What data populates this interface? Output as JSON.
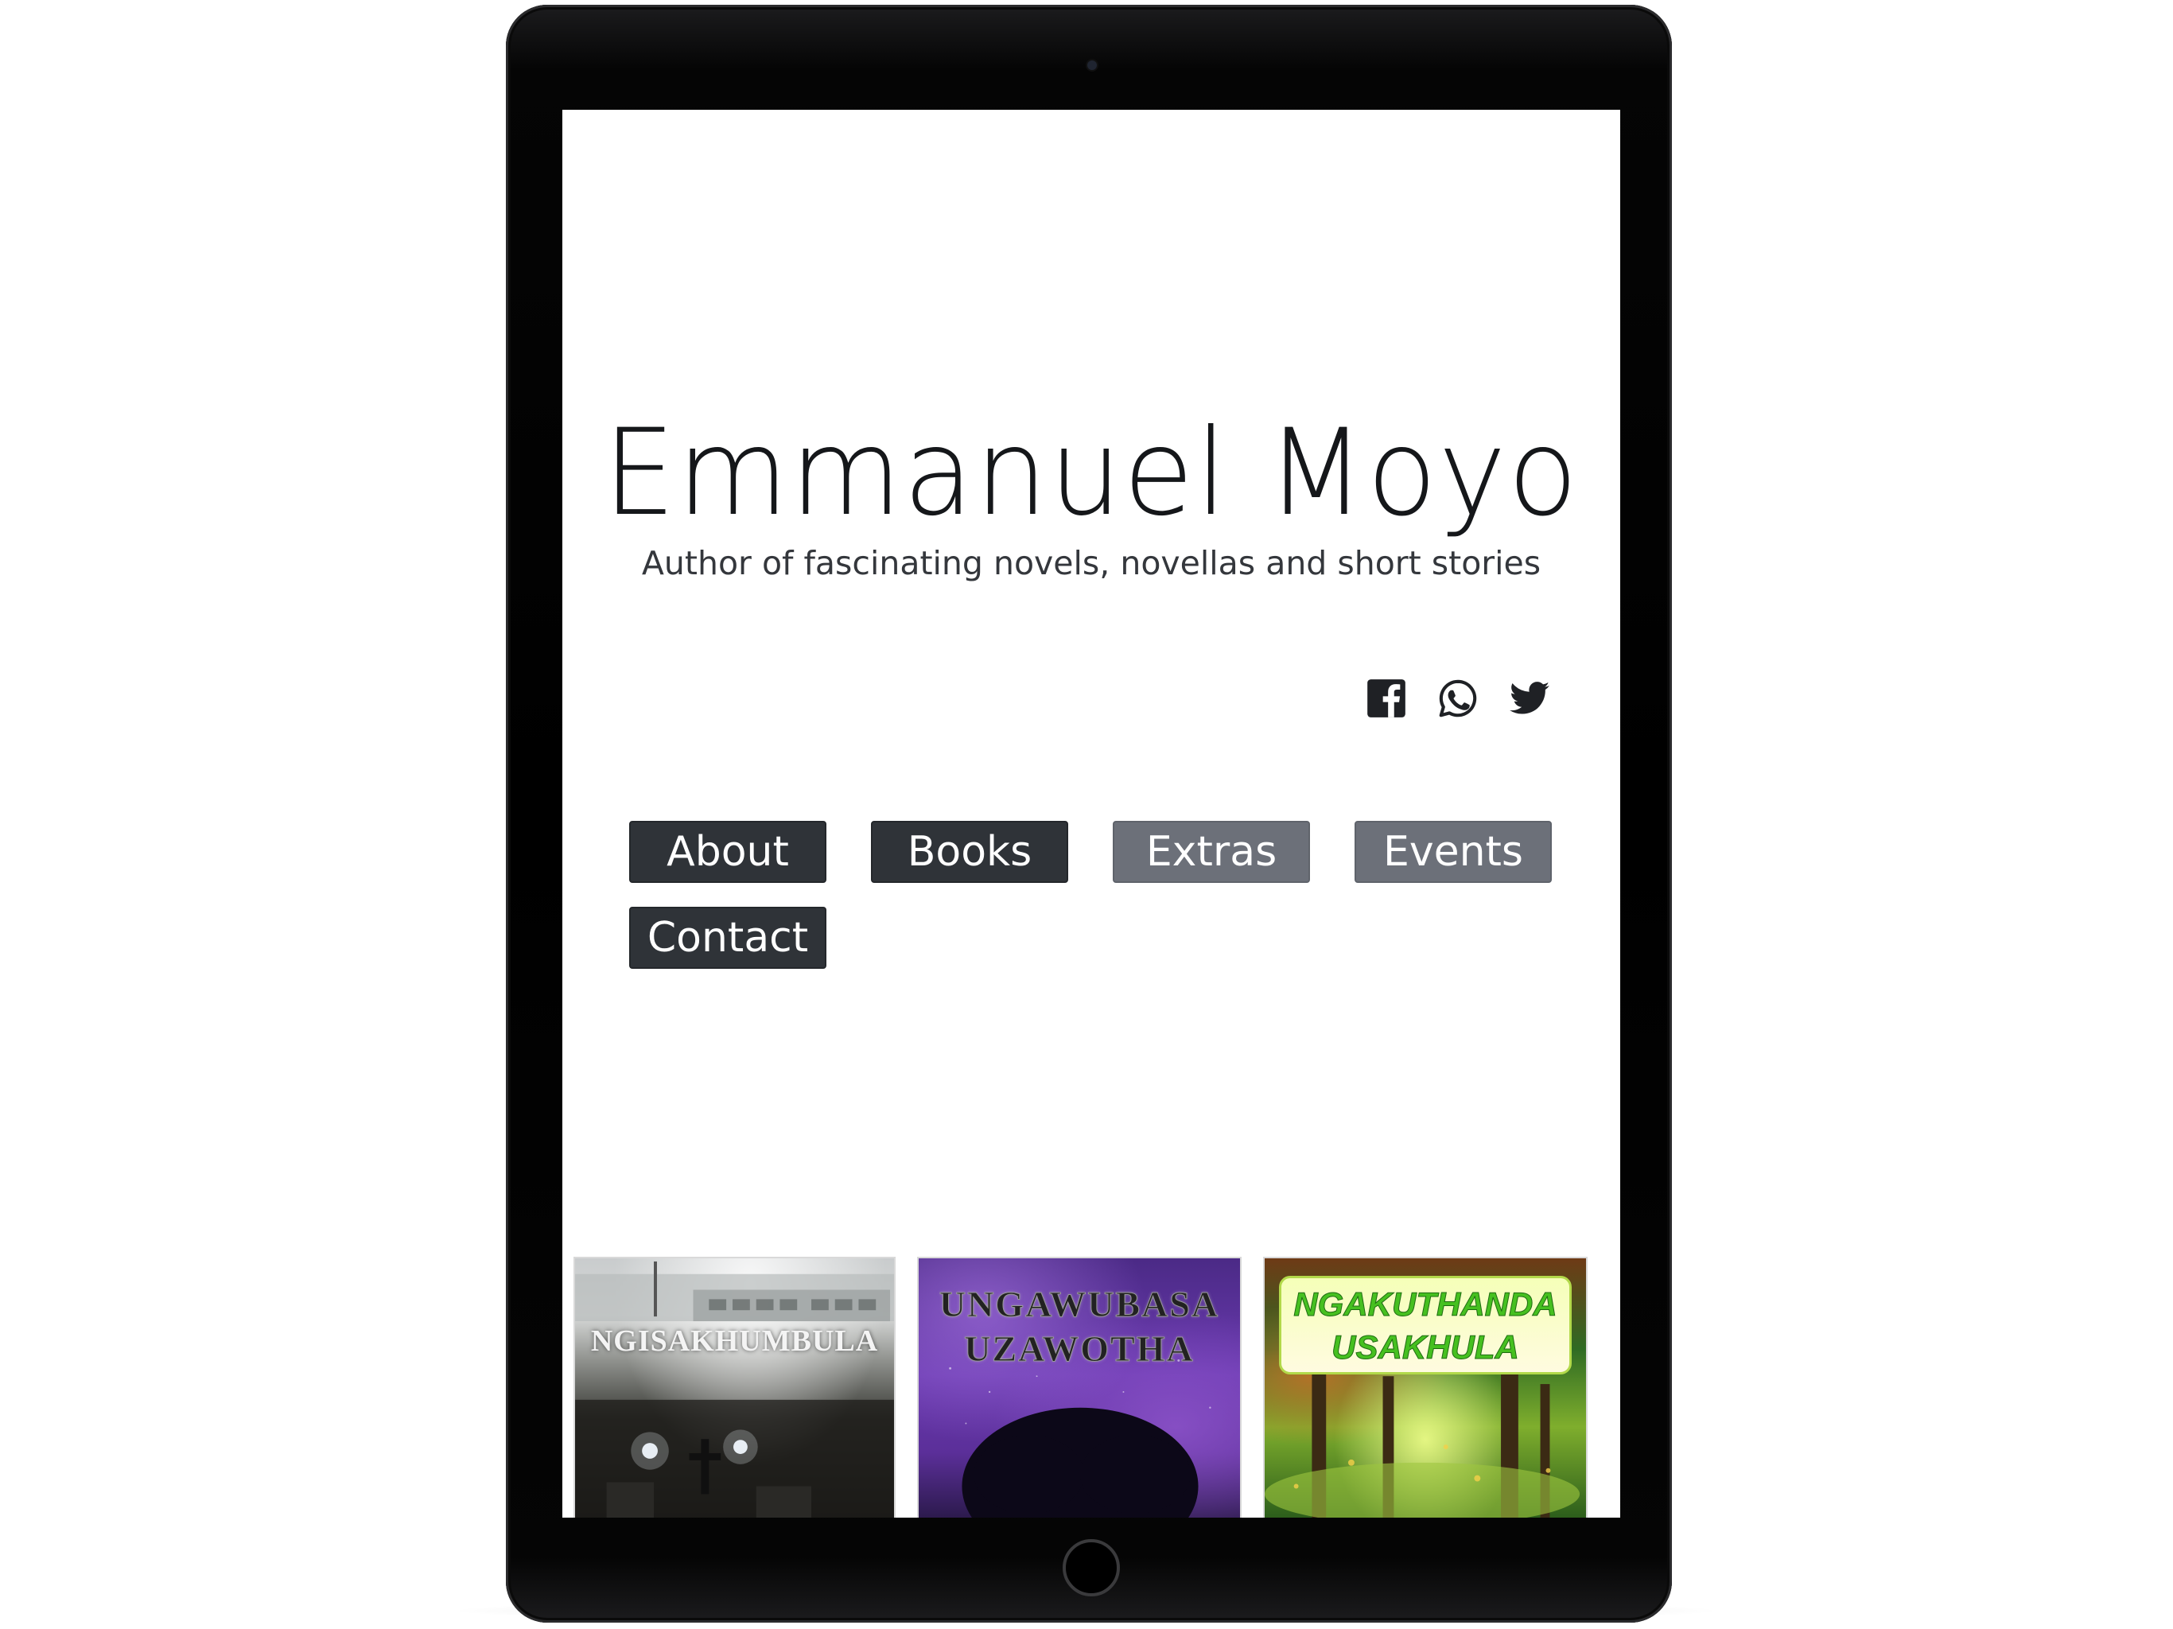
{
  "site": {
    "title": "Emmanuel Moyo",
    "tagline": "Author of fascinating novels, novellas and short stories"
  },
  "social": [
    {
      "name": "facebook",
      "icon": "facebook-icon"
    },
    {
      "name": "whatsapp",
      "icon": "whatsapp-icon"
    },
    {
      "name": "twitter",
      "icon": "twitter-icon"
    }
  ],
  "nav": {
    "items": [
      {
        "label": "About",
        "style": "dark"
      },
      {
        "label": "Books",
        "style": "dark"
      },
      {
        "label": "Extras",
        "style": "grey"
      },
      {
        "label": "Events",
        "style": "grey"
      },
      {
        "label": "Contact",
        "style": "dark"
      }
    ]
  },
  "books": [
    {
      "cover_title": "NGISAKHUMBULA"
    },
    {
      "cover_title": "UNGAWUBASA\nUZAWOTHA"
    },
    {
      "cover_title": "NGAKUTHANDA\nUSAKHULA"
    }
  ],
  "colors": {
    "nav_dark": "#2f3338",
    "nav_grey": "#6c7079",
    "title_text": "#15171a",
    "device_frame": "#000000"
  }
}
